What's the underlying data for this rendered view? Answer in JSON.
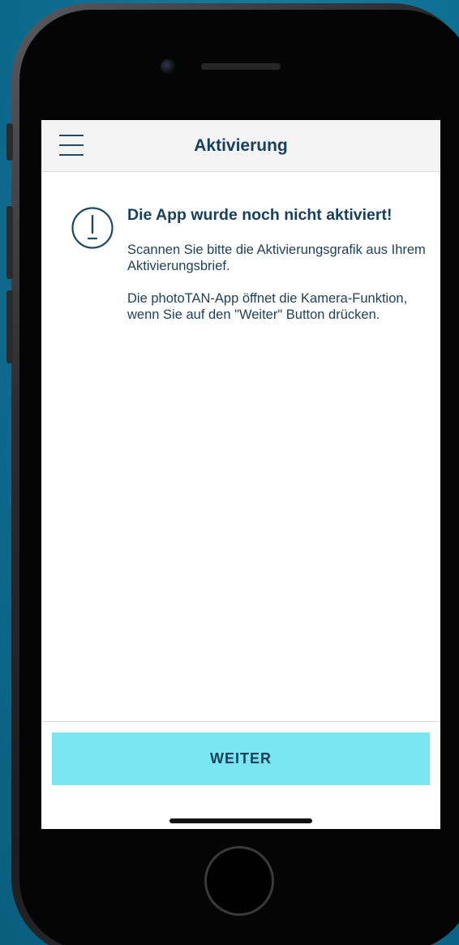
{
  "navbar": {
    "title": "Aktivierung",
    "menu_icon": "hamburger-menu-icon"
  },
  "notice": {
    "icon": "exclamation-circle-icon",
    "headline": "Die App wurde noch nicht aktiviert!",
    "paragraph_1": "Scannen Sie bitte die Aktivierungsgrafik aus Ihrem Aktivierungsbrief.",
    "paragraph_2": "Die photoTAN-App öffnet die Kamera-Funktion, wenn Sie auf den \"Weiter\" Button drücken."
  },
  "footer": {
    "button_label": "WEITER"
  },
  "colors": {
    "background": "#0b6f92",
    "primary_text": "#163f5c",
    "button": "#78e6f0",
    "navbar": "#f4f4f4"
  }
}
